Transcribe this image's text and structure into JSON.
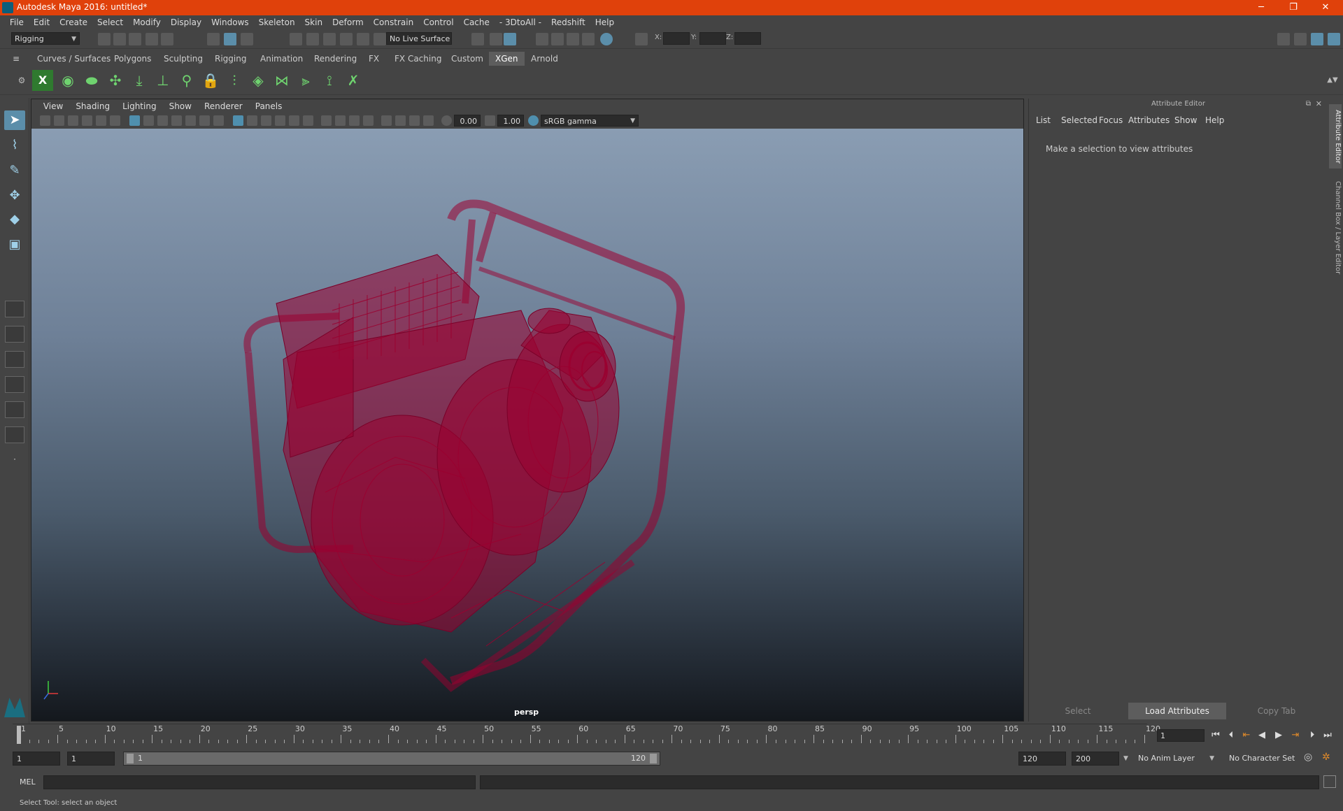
{
  "window": {
    "title": "Autodesk Maya 2016: untitled*",
    "minimize": "─",
    "restore": "❐",
    "close": "✕"
  },
  "menus": [
    "File",
    "Edit",
    "Create",
    "Select",
    "Modify",
    "Display",
    "Windows",
    "Skeleton",
    "Skin",
    "Deform",
    "Constrain",
    "Control",
    "Cache",
    "- 3DtoAll -",
    "Redshift",
    "Help"
  ],
  "status_line": {
    "menu_set": "Rigging",
    "live_surface": "No Live Surface",
    "x_label": "X:",
    "y_label": "Y:",
    "z_label": "Z:"
  },
  "shelf_tabs": [
    {
      "label": "Curves / Surfaces",
      "active": false
    },
    {
      "label": "Polygons",
      "active": false
    },
    {
      "label": "Sculpting",
      "active": false
    },
    {
      "label": "Rigging",
      "active": false
    },
    {
      "label": "Animation",
      "active": false
    },
    {
      "label": "Rendering",
      "active": false
    },
    {
      "label": "FX",
      "active": false
    },
    {
      "label": "FX Caching",
      "active": false
    },
    {
      "label": "Custom",
      "active": false
    },
    {
      "label": "XGen",
      "active": true
    },
    {
      "label": "Arnold",
      "active": false
    }
  ],
  "panel_menu": [
    "View",
    "Shading",
    "Lighting",
    "Show",
    "Renderer",
    "Panels"
  ],
  "panel_toolbar": {
    "exposure": "0.00",
    "gamma": "1.00",
    "color_space": "sRGB gamma"
  },
  "viewport": {
    "camera": "persp",
    "wire_color": "#9a0030"
  },
  "attribute_editor": {
    "title": "Attribute Editor",
    "menus": [
      "List",
      "Selected",
      "Focus",
      "Attributes",
      "Show",
      "Help"
    ],
    "message": "Make a selection to view attributes",
    "buttons": {
      "select": "Select",
      "load": "Load Attributes",
      "copy": "Copy Tab"
    }
  },
  "side_tabs": {
    "attribute_editor": "Attribute Editor",
    "channel_box": "Channel Box / Layer Editor"
  },
  "time_slider": {
    "labels": [
      "1",
      "5",
      "10",
      "15",
      "20",
      "25",
      "30",
      "35",
      "40",
      "45",
      "50",
      "55",
      "60",
      "65",
      "70",
      "75",
      "80",
      "85",
      "90",
      "95",
      "100",
      "105",
      "110",
      "115",
      "120"
    ],
    "current_frame": "1"
  },
  "range_slider": {
    "start_time": "1",
    "playback_start": "1",
    "range_start": "1",
    "range_end": "120",
    "playback_end": "120",
    "end_time": "200",
    "anim_layer": "No Anim Layer",
    "character_set": "No Character Set"
  },
  "command_line": {
    "label": "MEL"
  },
  "help_line": {
    "text": "Select Tool: select an object"
  },
  "colors": {
    "title_bar": "#e0410b",
    "accent": "#5b8eaa",
    "active_tab": "#5d5d5d"
  }
}
